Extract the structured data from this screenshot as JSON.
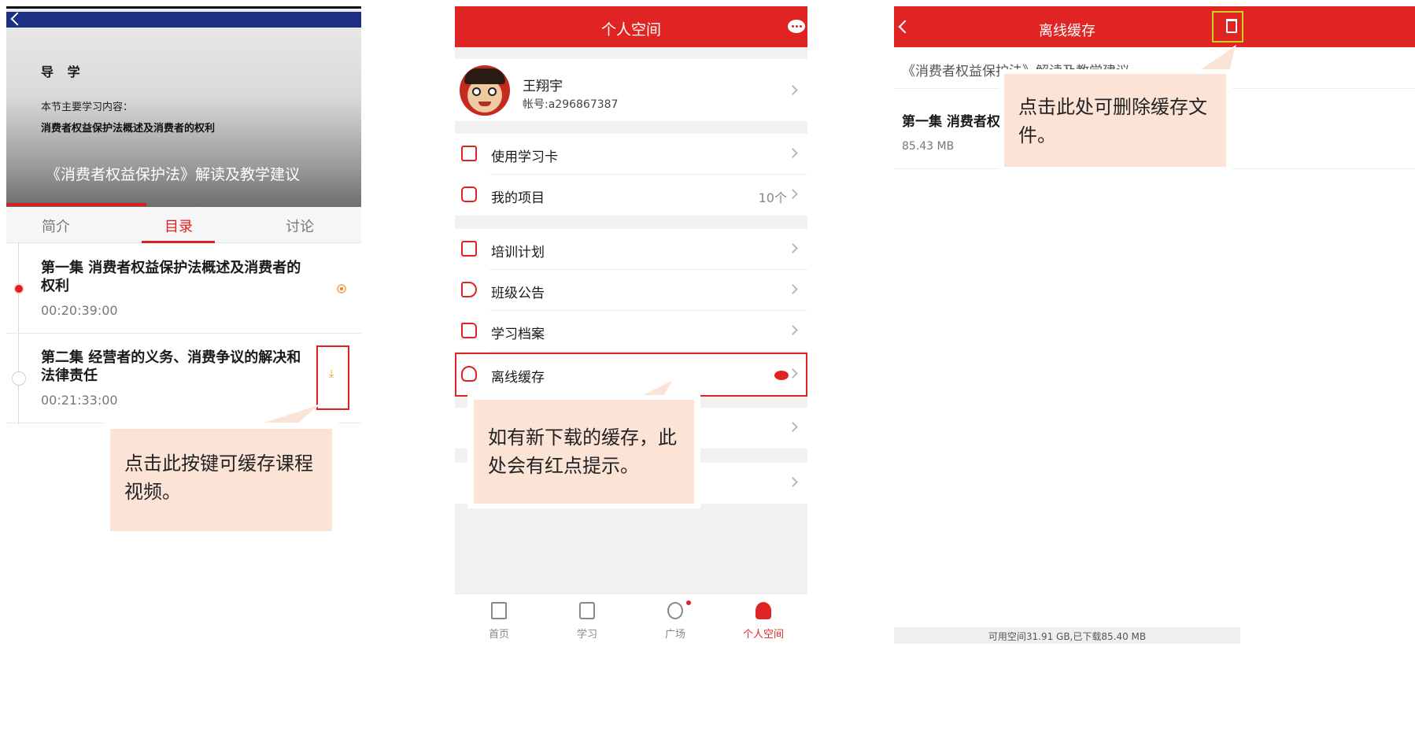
{
  "course_detail": {
    "guide_title": "导 学",
    "content_label": "本节主要学习内容：",
    "content_topic": "消费者权益保护法概述及消费者的权利",
    "course_title": "《消费者权益保护法》解读及教学建议",
    "tabs": [
      {
        "label": "简介",
        "active": false
      },
      {
        "label": "目录",
        "active": true
      },
      {
        "label": "讨论",
        "active": false
      }
    ],
    "episodes": [
      {
        "title": "第一集  消费者权益保护法概述及消费者的权利",
        "duration": "00:20:39:00",
        "current": true
      },
      {
        "title": "第二集  经营者的义务、消费争议的解决和法律责任",
        "duration": "00:21:33:00",
        "current": false
      }
    ],
    "callout": "点击此按键可缓存课程视频。",
    "accent_color": "#e02020",
    "download_icon": "download-icon"
  },
  "personal_space": {
    "title": "个人空间",
    "chat_icon": "chat-bubble-icon",
    "profile": {
      "name": "王翔宇",
      "account": "帐号:a296867387"
    },
    "menu_groups": [
      [
        {
          "label": "使用学习卡",
          "icon": "study-card-icon"
        },
        {
          "label": "我的项目",
          "icon": "project-list-icon",
          "count": "10个"
        }
      ],
      [
        {
          "label": "培训计划",
          "icon": "calendar-icon"
        },
        {
          "label": "班级公告",
          "icon": "megaphone-icon"
        },
        {
          "label": "学习档案",
          "icon": "folder-icon"
        },
        {
          "label": "离线缓存",
          "icon": "cloud-download-icon",
          "new_badge": true
        }
      ]
    ],
    "callout": "如有新下载的缓存，此处会有红点提示。",
    "bottom_nav": [
      {
        "label": "首页",
        "icon": "home-icon",
        "active": false
      },
      {
        "label": "学习",
        "icon": "book-icon",
        "active": false
      },
      {
        "label": "广场",
        "icon": "target-icon",
        "active": false,
        "badge": true
      },
      {
        "label": "个人空间",
        "icon": "user-icon",
        "active": true
      }
    ],
    "header_color": "#e02424"
  },
  "offline_cache": {
    "title": "离线缓存",
    "trash_icon": "trash-icon",
    "course_line": "《消费者权益保护法》解读及教学建议",
    "item": {
      "title": "第一集  消费者权益保护法概述及消费者的权利",
      "size": "85.43 MB"
    },
    "callout": "点击此处可删除缓存文件。",
    "footer": "可用空间31.91 GB,已下载85.40 MB"
  }
}
